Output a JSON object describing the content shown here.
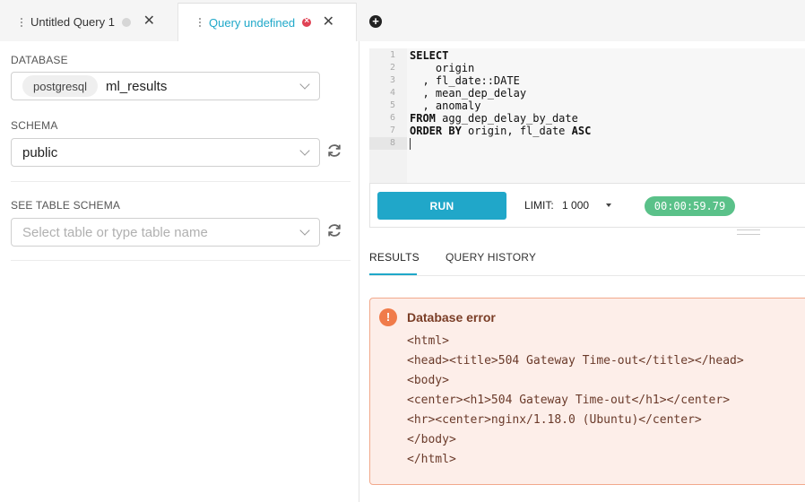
{
  "tabs": [
    {
      "title": "Untitled Query 1",
      "active": false
    },
    {
      "title": "Query undefined",
      "active": true
    }
  ],
  "left_panel": {
    "database": {
      "label": "DATABASE",
      "engine": "postgresql",
      "name": "ml_results"
    },
    "schema": {
      "label": "SCHEMA",
      "value": "public"
    },
    "table_schema": {
      "label": "SEE TABLE SCHEMA",
      "placeholder": "Select table or type table name"
    }
  },
  "editor": {
    "line_numbers": [
      "1",
      "2",
      "3",
      "4",
      "5",
      "6",
      "7",
      "8"
    ],
    "lines": [
      [
        {
          "t": "SELECT",
          "kw": true
        }
      ],
      [
        {
          "t": "    origin",
          "kw": false
        }
      ],
      [
        {
          "t": "  , fl_date::DATE",
          "kw": false
        }
      ],
      [
        {
          "t": "  , mean_dep_delay",
          "kw": false
        }
      ],
      [
        {
          "t": "  , anomaly",
          "kw": false
        }
      ],
      [
        {
          "t": "FROM",
          "kw": true
        },
        {
          "t": " agg_dep_delay_by_date",
          "kw": false
        }
      ],
      [
        {
          "t": "ORDER BY",
          "kw": true
        },
        {
          "t": " origin, fl_date ",
          "kw": false
        },
        {
          "t": "ASC",
          "kw": true
        }
      ],
      []
    ]
  },
  "toolbar": {
    "run_label": "RUN",
    "limit_label": "LIMIT:",
    "limit_value": "1 000",
    "timer": "00:00:59.79"
  },
  "results_tabs": {
    "results": "RESULTS",
    "history": "QUERY HISTORY"
  },
  "error": {
    "title": "Database error",
    "lines": [
      "<html>",
      "<head><title>504 Gateway Time-out</title></head>",
      "<body>",
      "<center><h1>504 Gateway Time-out</h1></center>",
      "<hr><center>nginx/1.18.0 (Ubuntu)</center>",
      "</body>",
      "</html>"
    ]
  },
  "colors": {
    "accent": "#1fa8c9",
    "run_button": "#20a7c9",
    "timer": "#5ac189",
    "error_bg": "#fdeee9",
    "error_border": "#f2a98c",
    "error_icon": "#f07b4a"
  }
}
